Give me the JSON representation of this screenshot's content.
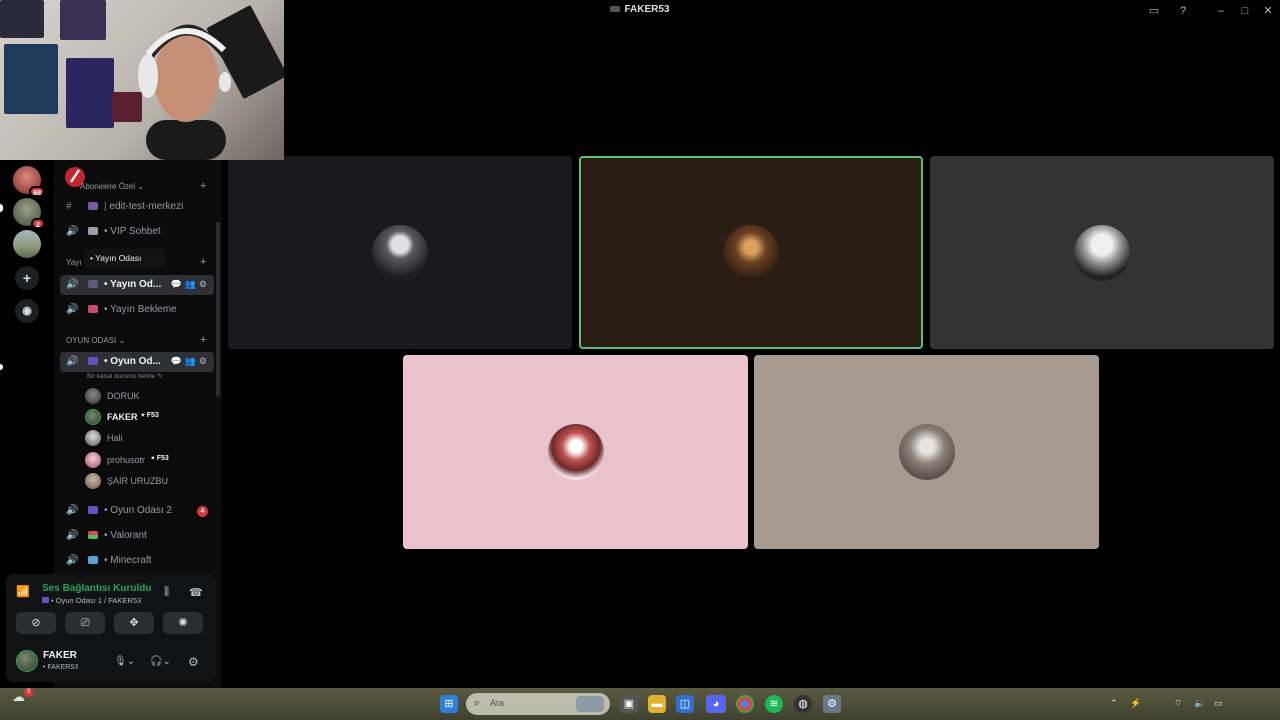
{
  "window": {
    "title": "FAKER53"
  },
  "rail": {
    "badges": [
      "68",
      "2"
    ]
  },
  "sidebar": {
    "categories": {
      "abonelere": "Abonelere Özel",
      "yayin": "Yayı",
      "oyun": "OYUN ODASI"
    },
    "channels": {
      "edit": "edit-test-merkezi",
      "vip": "• VIP Sohbet",
      "yayin_odasi": "• Yayın Od...",
      "yayin_bekleme": "• Yayın Bekleme",
      "oyun_odasi": "• Oyun Od...",
      "oyun_odasi_2": "• Oyun Odası 2",
      "valorant": "• Valorant",
      "minecraft": "• Minecraft"
    },
    "oyun_odasi_2_count": "4",
    "channel_status": "Bir kanal durumu belirle",
    "tooltip": "• Yayın Odası",
    "members": [
      {
        "name": "DORUK",
        "tag": ""
      },
      {
        "name": "FAKER",
        "tag": "F53"
      },
      {
        "name": "Hali",
        "tag": ""
      },
      {
        "name": "prohusotr",
        "tag": "F53"
      },
      {
        "name": "ŞAİR URUZBU",
        "tag": ""
      }
    ]
  },
  "voice": {
    "title": "Ses Bağlantısı Kuruldu",
    "subtitle": "• Oyun Odası 1 / FAKER53"
  },
  "user": {
    "name": "FAKER",
    "sub": "• FAKER53"
  },
  "taskbar": {
    "search_placeholder": "Ara",
    "notif_badge": "3"
  },
  "colors": {
    "accent_green": "#23a55a",
    "danger": "#da373c",
    "tile_speaking_border": "#5fbf7a"
  }
}
